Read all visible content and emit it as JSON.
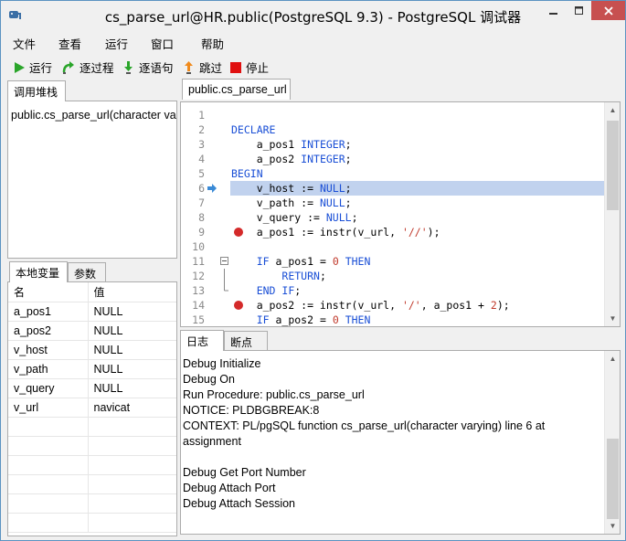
{
  "window": {
    "title": "cs_parse_url@HR.public(PostgreSQL 9.3) - PostgreSQL 调试器"
  },
  "menu": [
    "文件",
    "查看",
    "运行",
    "窗口",
    "帮助"
  ],
  "toolbar": {
    "run": "运行",
    "step_over": "逐过程",
    "step_into": "逐语句",
    "step_out": "跳过",
    "stop": "停止"
  },
  "call_stack": {
    "tab_label": "调用堆栈",
    "items": [
      "public.cs_parse_url(character varying)"
    ]
  },
  "variables": {
    "tabs": [
      "本地变量",
      "参数"
    ],
    "headers": [
      "名",
      "值"
    ],
    "rows": [
      {
        "name": "a_pos1",
        "value": "NULL"
      },
      {
        "name": "a_pos2",
        "value": "NULL"
      },
      {
        "name": "v_host",
        "value": "NULL"
      },
      {
        "name": "v_path",
        "value": "NULL"
      },
      {
        "name": "v_query",
        "value": "NULL"
      },
      {
        "name": "v_url",
        "value": "navicat"
      }
    ]
  },
  "editor": {
    "tab_label": "public.cs_parse_url",
    "current_line": 6,
    "breakpoints": [
      9,
      14
    ],
    "lines": [
      {
        "n": "1",
        "t": ""
      },
      {
        "n": "2",
        "t": "DECLARE"
      },
      {
        "n": "3",
        "t": "    a_pos1 INTEGER;"
      },
      {
        "n": "4",
        "t": "    a_pos2 INTEGER;"
      },
      {
        "n": "5",
        "t": "BEGIN"
      },
      {
        "n": "6",
        "t": "    v_host := NULL;"
      },
      {
        "n": "7",
        "t": "    v_path := NULL;"
      },
      {
        "n": "8",
        "t": "    v_query := NULL;"
      },
      {
        "n": "9",
        "t": "    a_pos1 := instr(v_url, '//');"
      },
      {
        "n": "10",
        "t": ""
      },
      {
        "n": "11",
        "t": "    IF a_pos1 = 0 THEN"
      },
      {
        "n": "12",
        "t": "        RETURN;"
      },
      {
        "n": "13",
        "t": "    END IF;"
      },
      {
        "n": "14",
        "t": "    a_pos2 := instr(v_url, '/', a_pos1 + 2);"
      },
      {
        "n": "15",
        "t": "    IF a_pos2 = 0 THEN"
      }
    ]
  },
  "log": {
    "tabs": [
      "日志",
      "断点"
    ],
    "lines": [
      "Debug Initialize",
      "Debug On",
      "Run Procedure: public.cs_parse_url",
      "NOTICE:  PLDBGBREAK:8",
      "CONTEXT:  PL/pgSQL function cs_parse_url(character varying) line 6 at",
      "assignment",
      "",
      "Debug Get Port Number",
      "Debug Attach Port",
      "Debug Attach Session"
    ]
  },
  "colors": {
    "keyword": "#1a4fd6",
    "string": "#c0392b",
    "current_line_bg": "#c1d2ee",
    "breakpoint": "#d42a2a",
    "close_button": "#c75050"
  }
}
